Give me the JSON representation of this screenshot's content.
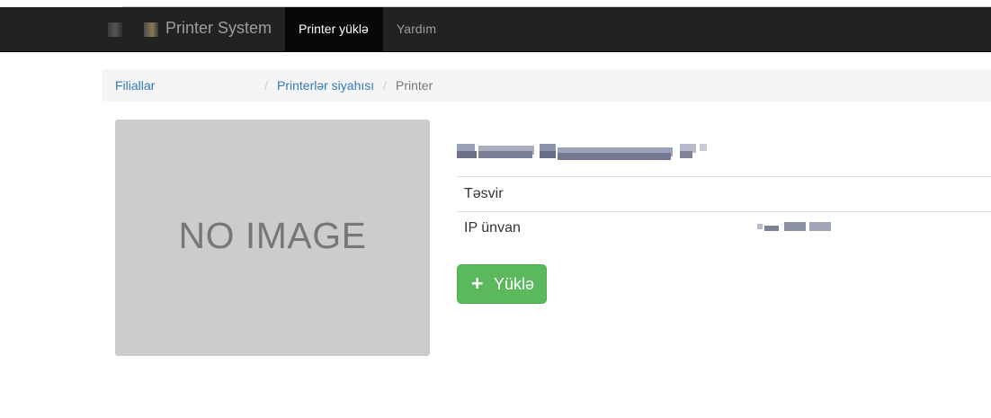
{
  "navbar": {
    "brand": "Printer System",
    "active_item": "Printer yüklə",
    "help_item": "Yardım",
    "colors": {
      "background": "#222222",
      "active_background": "#080808"
    }
  },
  "breadcrumb": {
    "items": [
      "Filiallar",
      "Printerlər siyahısı"
    ],
    "separator": "/",
    "current": "Printer"
  },
  "image_placeholder": {
    "text": "NO IMAGE"
  },
  "details": {
    "rows": [
      {
        "label": "Təsvir",
        "value": ""
      },
      {
        "label": "IP ünvan",
        "value": ""
      }
    ]
  },
  "actions": {
    "upload_label": "Yüklə",
    "upload_icon": "plus-icon",
    "color": "#5cb85c"
  }
}
